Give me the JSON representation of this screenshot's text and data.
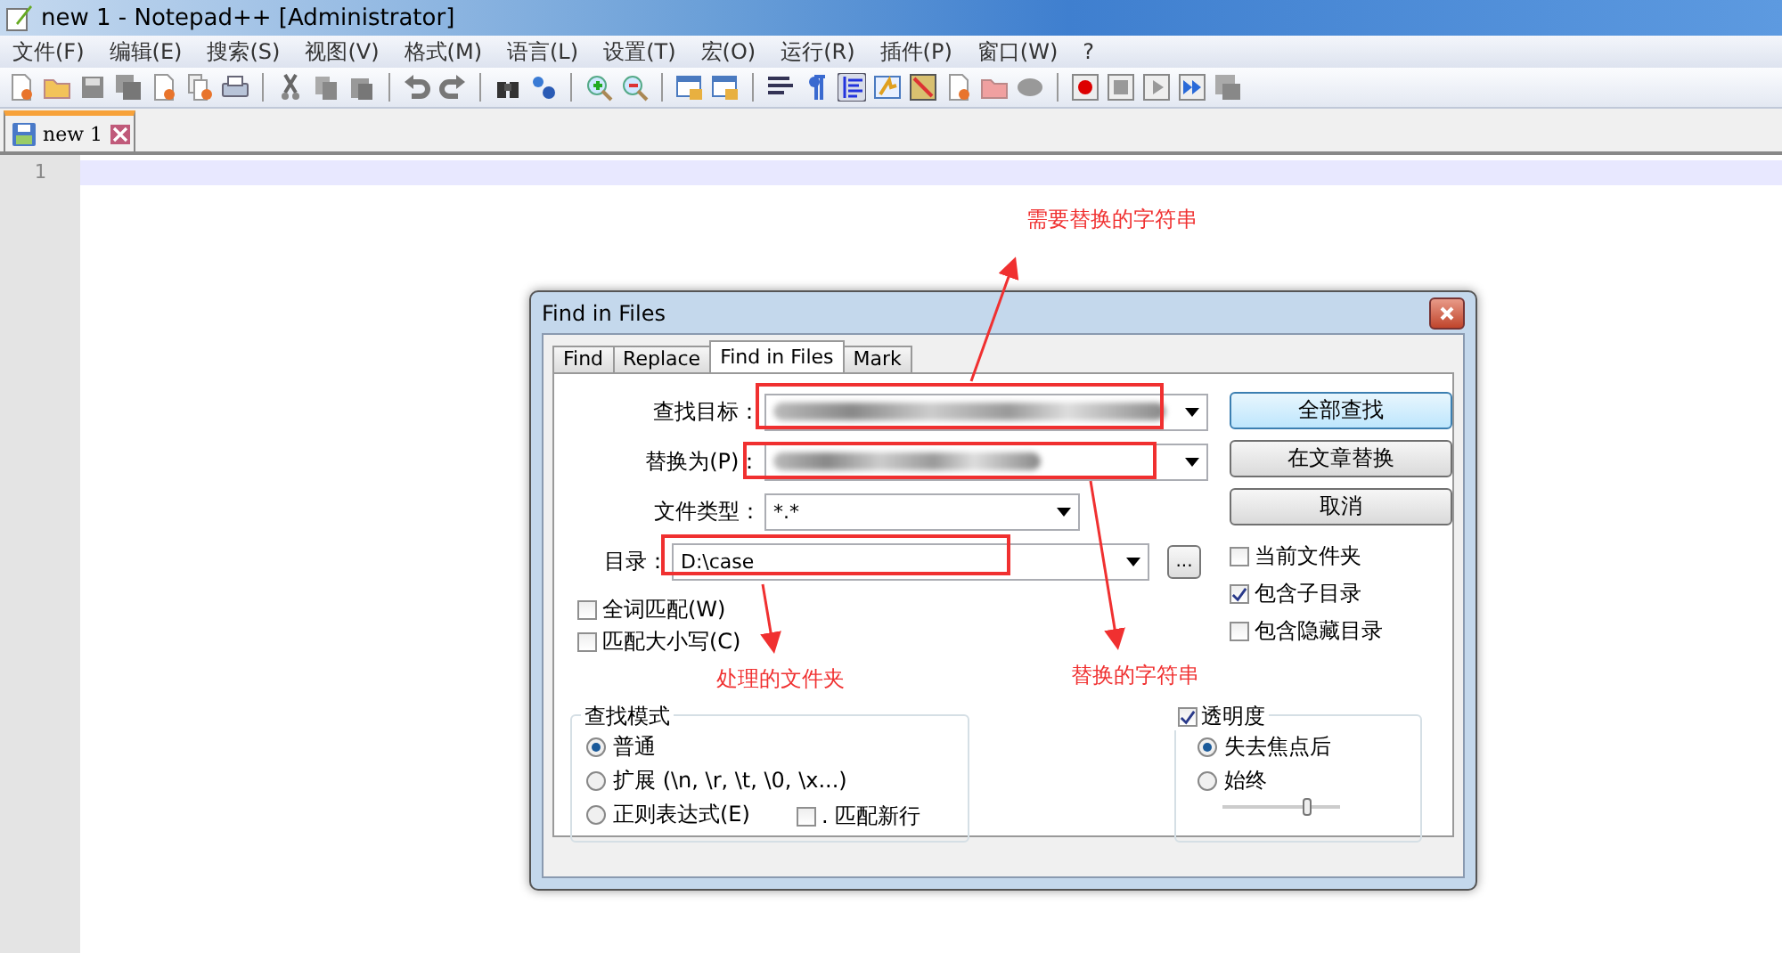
{
  "window": {
    "title": "new 1 - Notepad++ [Administrator]"
  },
  "menu": [
    "文件(F)",
    "编辑(E)",
    "搜索(S)",
    "视图(V)",
    "格式(M)",
    "语言(L)",
    "设置(T)",
    "宏(O)",
    "运行(R)",
    "插件(P)",
    "窗口(W)",
    "?"
  ],
  "tabs": [
    {
      "label": "new 1",
      "selected": true
    }
  ],
  "editor": {
    "line_numbers": [
      "1"
    ]
  },
  "dialog": {
    "title": "Find in Files",
    "tabs": [
      {
        "label": "Find",
        "selected": false
      },
      {
        "label": "Replace",
        "selected": false
      },
      {
        "label": "Find in Files",
        "selected": true
      },
      {
        "label": "Mark",
        "selected": false
      }
    ],
    "fields": [
      {
        "label": "查找目标：",
        "kind": "blurred"
      },
      {
        "label": "替换为(P)：",
        "kind": "blurred"
      },
      {
        "label": "文件类型：",
        "kind": "text",
        "value": "*.*"
      },
      {
        "label": "目录：",
        "kind": "text",
        "value": "D:\\case"
      }
    ],
    "browse_button": "...",
    "buttons": [
      {
        "label": "全部查找",
        "default": true
      },
      {
        "label": "在文章替换",
        "default": false
      },
      {
        "label": "取消",
        "default": false
      }
    ],
    "right_options": [
      {
        "label": "当前文件夹",
        "checked": false
      },
      {
        "label": "包含子目录",
        "checked": true
      },
      {
        "label": "包含隐藏目录",
        "checked": false
      }
    ],
    "left_options": [
      {
        "label": "全词匹配(W)",
        "checked": false
      },
      {
        "label": "匹配大小写(C)",
        "checked": false
      }
    ],
    "search_mode": {
      "title": "查找模式",
      "options": [
        {
          "label": "普通",
          "selected": true
        },
        {
          "label": "扩展 (\\n, \\r, \\t, \\0, \\x...)",
          "selected": false
        },
        {
          "label": "正则表达式(E)",
          "selected": false
        }
      ],
      "dot_newline": {
        "label": ". 匹配新行",
        "checked": false
      }
    },
    "transparency": {
      "label": "透明度",
      "checked": true,
      "options": [
        {
          "label": "失去焦点后",
          "selected": true
        },
        {
          "label": "始终",
          "selected": false
        }
      ],
      "level": 0.72
    }
  },
  "annotations": [
    {
      "label": "需要替换的字符串"
    },
    {
      "label": "处理的文件夹"
    },
    {
      "label": "替换的字符串"
    }
  ]
}
